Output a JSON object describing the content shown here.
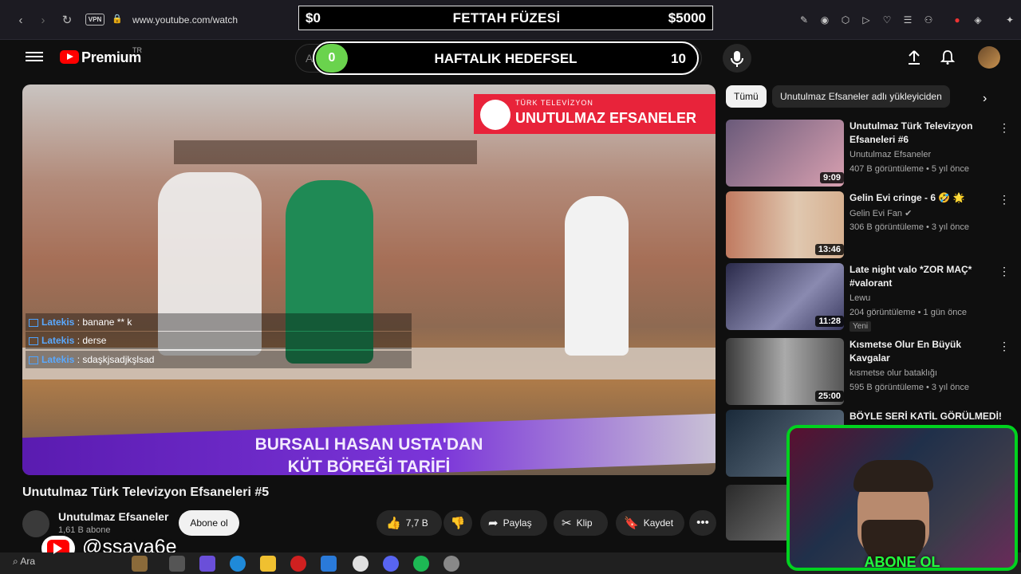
{
  "browser": {
    "url": "www.youtube.com/watch",
    "vpn_label": "VPN"
  },
  "stream_goal": {
    "min_label": "$0",
    "title": "FETTAH FÜZESİ",
    "max_label": "$5000"
  },
  "weekly_goal": {
    "current": "0",
    "title": "HAFTALIK HEDEFSEL",
    "target": "10"
  },
  "header": {
    "logo_text": "Premium",
    "region": "TR",
    "search_placeholder": "Ara"
  },
  "video": {
    "banner_small": "TÜRK TELEVİZYON",
    "banner_title": "UNUTULMAZ EFSANELER",
    "lower_third_line1": "BURSALI HASAN USTA'DAN",
    "lower_third_line2": "KÜT BÖREĞİ TARİFİ",
    "title": "Unutulmaz Türk Televizyon Efsaneleri #5"
  },
  "chat": [
    {
      "user": "Latekis",
      "message": ": banane ** k"
    },
    {
      "user": "Latekis",
      "message": ": derse"
    },
    {
      "user": "Latekis",
      "message": ": sdaşkjsadjkşlsad"
    }
  ],
  "channel": {
    "name": "Unutulmaz Efsaneler",
    "subscribers": "1,61 B abone",
    "subscribe_label": "Abone ol"
  },
  "actions": {
    "likes": "7,7 B",
    "share": "Paylaş",
    "clip": "Klip",
    "save": "Kaydet"
  },
  "streamer_handle": "@ssava6e",
  "taskbar": {
    "search_label": "Ara"
  },
  "sidebar": {
    "chips": [
      "Tümü",
      "Unutulmaz Efsaneler adlı yükleyiciden"
    ],
    "recommendations": [
      {
        "title": "Unutulmaz Türk Televizyon Efsaneleri #6",
        "channel": "Unutulmaz Efsaneler",
        "meta": "407 B görüntüleme • 5 yıl önce",
        "duration": "9:09",
        "badge": ""
      },
      {
        "title": "Gelin Evi cringe - 6 🤣 🌟",
        "channel": "Gelin Evi Fan ✔",
        "meta": "306 B görüntüleme • 3 yıl önce",
        "duration": "13:46",
        "badge": ""
      },
      {
        "title": "Late night valo *ZOR MAÇ* #valorant",
        "channel": "Lewu",
        "meta": "204 görüntüleme • 1 gün önce",
        "duration": "11:28",
        "badge": "Yeni"
      },
      {
        "title": "Kısmetse Olur En Büyük Kavgalar",
        "channel": "kısmetse olur bataklığı",
        "meta": "595 B görüntüleme • 3 yıl önce",
        "duration": "25:00",
        "badge": ""
      },
      {
        "title": "BÖYLE SERİ KATİL GÖRÜLMEDİ!",
        "channel": "",
        "meta": "",
        "duration": "",
        "badge": ""
      }
    ]
  },
  "webcam_label": "ABONE OL",
  "colors": {
    "accent_red": "#ff0000",
    "goal_green": "#6ad34d",
    "webcam_border": "#00d21f"
  }
}
